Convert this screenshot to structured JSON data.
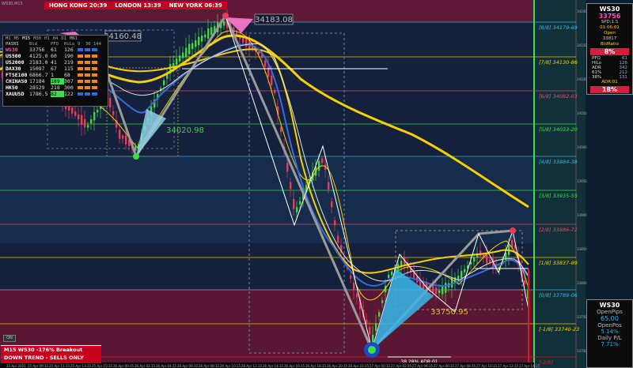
{
  "platform_label": "WS30,M15",
  "sessions": [
    {
      "label": "HONG KONG 20:39"
    },
    {
      "label": "LONDON 13:39"
    },
    {
      "label": "NEW YORK 06:39"
    }
  ],
  "pairs_panel": {
    "timeframes": [
      "M1",
      "M5",
      "M15",
      "M30",
      "H1",
      "H4",
      "D1",
      "MN1"
    ],
    "headers": [
      "PAIRS",
      "Bid",
      "PFO",
      "HiLo",
      "9",
      "36",
      "144"
    ],
    "rows": [
      {
        "pair": "WS30",
        "bid": "33756",
        "pfo": "61",
        "hilo": "126",
        "color": "#ff4fc8"
      },
      {
        "pair": "US500",
        "bid": "4125.0",
        "pfo": "60",
        "hilo": "190",
        "color": "#ffffff"
      },
      {
        "pair": "US2000",
        "bid": "2183.0",
        "pfo": "41",
        "hilo": "219",
        "color": "#ffffff"
      },
      {
        "pair": "DAX30",
        "bid": "15097",
        "pfo": "67",
        "hilo": "115",
        "color": "#ffffff"
      },
      {
        "pair": "FTSE100",
        "bid": "6866.7",
        "pfo": "1",
        "hilo": "68",
        "color": "#ffffff"
      },
      {
        "pair": "CHINA50",
        "bid": "17184",
        "pfo": "189",
        "hilo": "307",
        "color": "#ffffff",
        "hl": "#39e04a"
      },
      {
        "pair": "HK50",
        "bid": "28529",
        "pfo": "218",
        "hilo": "300",
        "color": "#ffffff"
      },
      {
        "pair": "XAUUSD",
        "bid": "1786.5",
        "pfo": "82",
        "hilo": "122",
        "color": "#ffffff",
        "hl": "#39e04a"
      }
    ]
  },
  "price_labels": {
    "top_high": "34183.08",
    "left_high": "34160.48",
    "left_low": "34020.98",
    "lower": "33750.95"
  },
  "levels": [
    {
      "label": "[8/8]  34179-69"
    },
    {
      "label": "[7/8]  34130-86"
    },
    {
      "label": "[6/8]  34082-03"
    },
    {
      "label": "[5/8]  34033-20"
    },
    {
      "label": "[4/8]  33984-38"
    },
    {
      "label": "[3/8]  33935-55"
    },
    {
      "label": "[2/8]  33886-72"
    },
    {
      "label": "[1/8]  33837-89"
    },
    {
      "label": "[0/8]  33789-06"
    },
    {
      "label": "[-1/8]  33740-23"
    },
    {
      "label": "[-2/8]"
    }
  ],
  "adr_label": "38.28% ADR:01",
  "on_button": "ON",
  "trend_box": {
    "line1": "M15 WS30 -176% Breakout",
    "line2": "DOWN TREND - SELLS ONLY"
  },
  "right_panel": {
    "symbol": "WS30",
    "price": "33756",
    "spd": "SPD:1.5",
    "time": "01:06:01",
    "open_label": "Open",
    "open": "33817",
    "bid_ratio_label": "BidRatio",
    "bid_ratio": "8%",
    "stats": [
      [
        "PFO",
        "61"
      ],
      [
        "HiLo",
        "126"
      ],
      [
        "ADR",
        "342"
      ],
      [
        "61%",
        "212"
      ],
      [
        "38%",
        "131"
      ]
    ],
    "adr_label": "ADR:01",
    "adr_pct": "18%"
  },
  "pips_panel": {
    "symbol": "WS30",
    "open_pips_label": "OpenPips",
    "open_pips": "65.00",
    "open_pos_label": "OpenPos",
    "open_pos": "5.14%",
    "daily_label": "Daily P/L",
    "daily": "7.71%"
  },
  "x_axis": [
    "25 Apr 2021",
    "25 Apr 09:15",
    "25 Apr 11:15",
    "25 Apr 13:15",
    "25 Apr 15:15",
    "26 Apr 00:15",
    "26 Apr 02:15",
    "26 Apr 04:15",
    "26 Apr 06:15",
    "26 Apr 08:15",
    "26 Apr 10:15",
    "26 Apr 12:15",
    "26 Apr 14:15",
    "26 Apr 16:15",
    "26 Apr 18:15",
    "26 Apr 20:15",
    "26 Apr 22:15",
    "27 Apr 00:15",
    "27 Apr 02:15",
    "27 Apr 04:15",
    "27 Apr 06:15",
    "27 Apr 08:15",
    "27 Apr 10:15",
    "27 Apr 12:15",
    "27 Apr 14:15"
  ],
  "y_axis": [
    "34200",
    "34150",
    "34100",
    "34050",
    "34000",
    "33950",
    "33900",
    "33850",
    "33800",
    "33750",
    "33700"
  ]
}
